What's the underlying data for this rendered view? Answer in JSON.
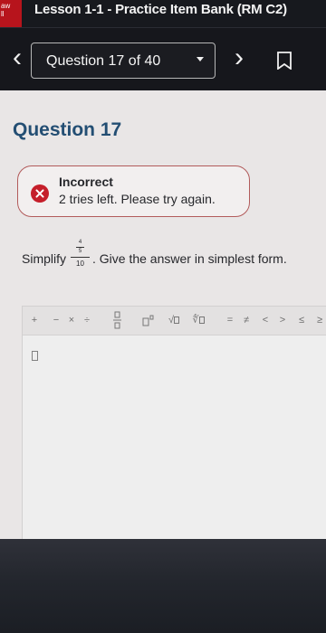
{
  "header": {
    "app_badge_lines": [
      "aw",
      "ll"
    ],
    "title": "Lesson 1-1 - Practice Item Bank (RM C2)"
  },
  "navigation": {
    "question_selector": "Question 17 of 40",
    "back_icon": "chevron-left-icon",
    "next_icon": "chevron-right-icon",
    "bookmark_icon": "bookmark-icon"
  },
  "question": {
    "title": "Question 17",
    "feedback": {
      "title": "Incorrect",
      "message": "2 tries left. Please try again.",
      "icon": "close-circle-icon",
      "border_color": "#b25b5b",
      "icon_color": "#c51e2a"
    },
    "prompt": {
      "prefix": "Simplify",
      "fraction_top_numerator": "4",
      "fraction_top_denominator": "5",
      "fraction_denominator": "10",
      "suffix": ". Give the answer in simplest form."
    }
  },
  "toolbar": {
    "plus": "+",
    "minus": "−",
    "times": "×",
    "divide": "÷",
    "fraction_label": "fraction",
    "exponent_label": "exponent",
    "sqrt": "√",
    "nthroot": "∜",
    "equals": "=",
    "not_equal": "≠",
    "less_than": "<",
    "greater_than": ">",
    "less_equal": "≤",
    "greater_equal": "≥"
  },
  "answer": {
    "value": ""
  },
  "colors": {
    "header_bg": "#17191e",
    "title_color": "#234e73",
    "panel_bg": "#e9e6e6"
  }
}
